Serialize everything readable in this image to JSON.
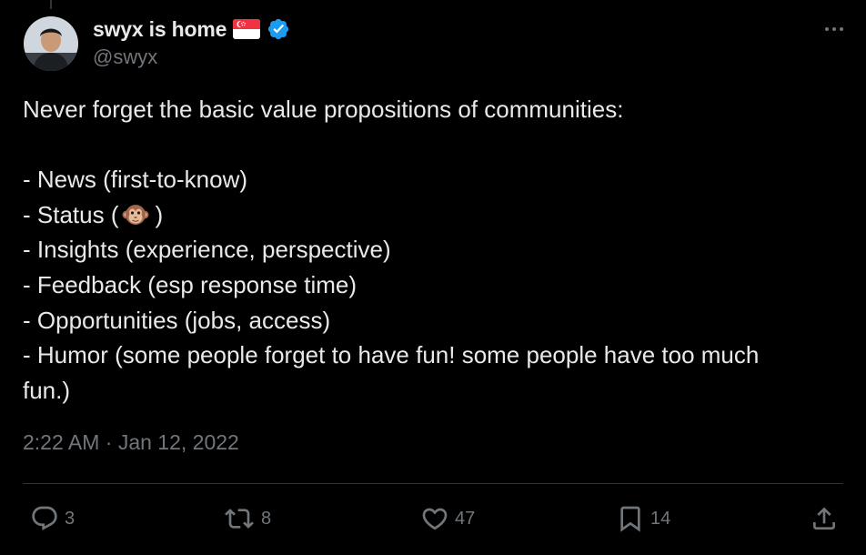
{
  "author": {
    "display_name": "swyx is home",
    "handle": "@swyx",
    "verified": true,
    "flag_icon": "singapore-flag-icon",
    "verified_icon": "verified-badge-icon",
    "verified_color": "#1d9bf0"
  },
  "tweet": {
    "lines": [
      "Never forget the basic value propositions of communities:",
      "",
      "- News (first-to-know)",
      "- Insights (experience, perspective)",
      "- Feedback (esp response time)",
      "- Opportunities (jobs, access)",
      "- Humor (some people forget to have fun! some people have too much",
      "fun.)"
    ],
    "status_line_prefix": "- Status (",
    "status_line_suffix": ")",
    "status_emoji_icon": "monkey-face-icon",
    "timestamp": "2:22 AM · Jan 12, 2022"
  },
  "actions": {
    "replies": "3",
    "reposts": "8",
    "likes": "47",
    "bookmarks": "14"
  },
  "colors": {
    "background": "#000000",
    "text": "#e7e9ea",
    "secondary_text": "#71767b",
    "divider": "#2f3336"
  }
}
